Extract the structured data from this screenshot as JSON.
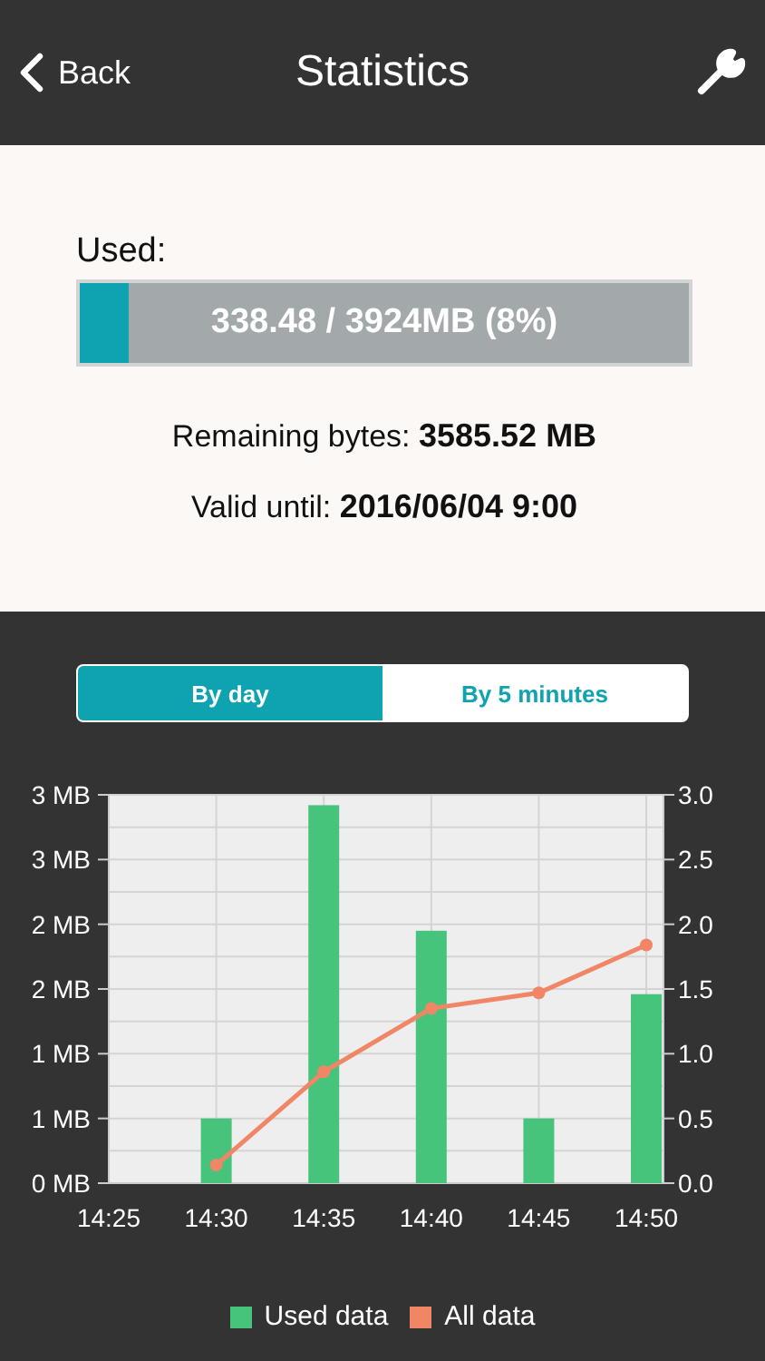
{
  "header": {
    "back": "Back",
    "title": "Statistics"
  },
  "usage": {
    "label": "Used:",
    "level": 0.08,
    "reading": "338.48 / 3924MB (8%)",
    "remaining_label": "Remaining bytes:",
    "remaining_value": "3585.52 MB",
    "valid_label": "Valid until:",
    "valid_value": "2016/06/04 9:00"
  },
  "tabs": [
    {
      "label": "By day",
      "selected": true
    },
    {
      "label": "By 5 minutes",
      "selected": false
    }
  ],
  "chart": {
    "chart_data": {
      "type": "bar",
      "categories": [
        "14:25",
        "14:30",
        "14:35",
        "14:40",
        "14:45",
        "14:50"
      ],
      "series": [
        {
          "name": "Used data",
          "color": "#46c47c",
          "type": "bar",
          "values": [
            null,
            0.5,
            2.92,
            1.95,
            0.5,
            1.46
          ]
        },
        {
          "name": "All data",
          "color": "#f08665",
          "type": "line",
          "marker": "circle",
          "values": [
            null,
            0.14,
            0.86,
            1.35,
            1.47,
            1.84
          ]
        }
      ],
      "ylim": [
        0,
        3
      ],
      "y2lim": [
        0,
        3
      ],
      "grid": true,
      "yticks": [
        {
          "value": 0,
          "label": "0 MB"
        },
        {
          "value": 0.5,
          "label": "1 MB"
        },
        {
          "value": 1,
          "label": "1 MB"
        },
        {
          "value": 1.5,
          "label": "2 MB"
        },
        {
          "value": 2,
          "label": "2 MB"
        },
        {
          "value": 2.5,
          "label": "3 MB"
        },
        {
          "value": 3,
          "label": "3 MB"
        }
      ],
      "y2ticks": [
        {
          "value": 0,
          "label": "0.0"
        },
        {
          "value": 0.5,
          "label": "0.5"
        },
        {
          "value": 1,
          "label": "1.0"
        },
        {
          "value": 1.5,
          "label": "1.5"
        },
        {
          "value": 2,
          "label": "2.0"
        },
        {
          "value": 2.5,
          "label": "2.5"
        },
        {
          "value": 3,
          "label": "3.0"
        }
      ]
    }
  }
}
